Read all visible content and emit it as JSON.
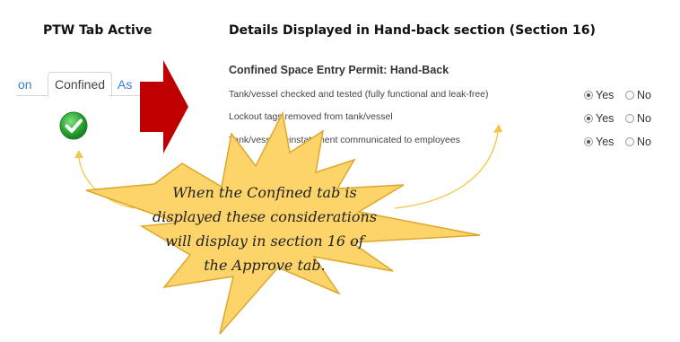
{
  "headings": {
    "left": "PTW Tab Active",
    "right": "Details Displayed in Hand-back section (Section 16)"
  },
  "tabs": {
    "prev_partial": "on",
    "active": "Confined",
    "next_partial": "As"
  },
  "section": {
    "title": "Confined Space Entry Permit: Hand-Back",
    "rows": [
      {
        "label": "Tank/vessel checked and tested (fully functional and leak-free)",
        "yes": "Yes",
        "no": "No",
        "selected": "Yes"
      },
      {
        "label": "Lockout tags removed from tank/vessel",
        "yes": "Yes",
        "no": "No",
        "selected": "Yes"
      },
      {
        "label": "Tank/vessel reinstatement communicated to employees",
        "yes": "Yes",
        "no": "No",
        "selected": "Yes"
      }
    ]
  },
  "callout": {
    "lines": [
      "When the Confined tab is",
      "displayed these considerations",
      "will display in section 16 of",
      "the Approve tab."
    ]
  },
  "colors": {
    "arrow": "#c00000",
    "star_fill": "#fcd46a",
    "star_stroke": "#e0a62a",
    "check": "#2fa836",
    "tab_link": "#3a7fd0"
  },
  "icons": {
    "check": "check-circle-icon",
    "arrow": "right-arrow-icon"
  }
}
